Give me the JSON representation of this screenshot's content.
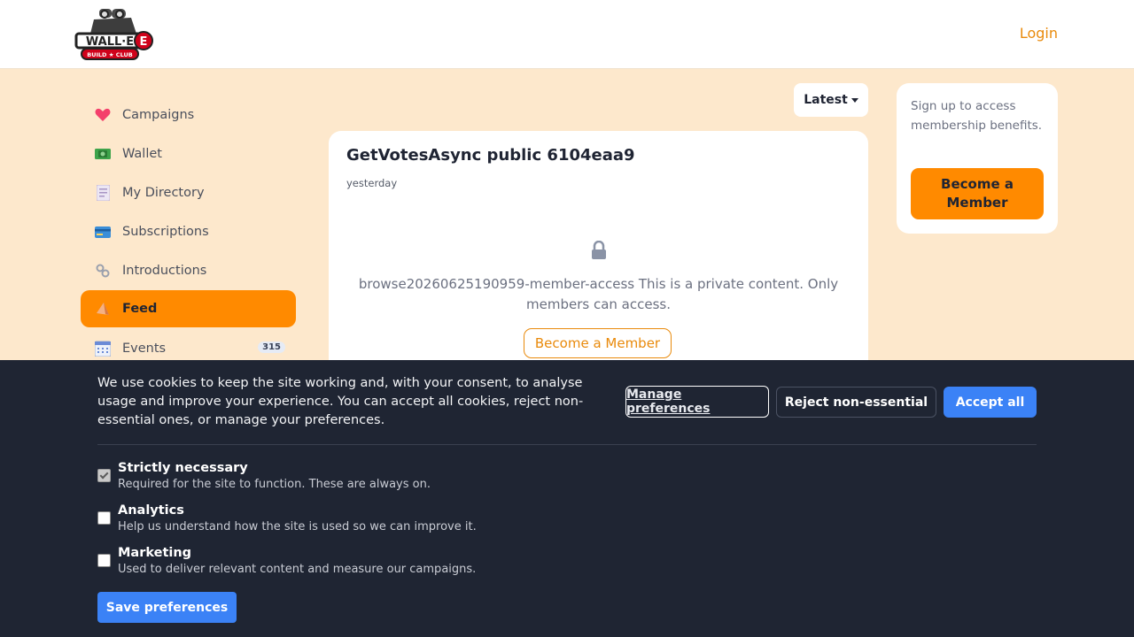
{
  "header": {
    "logo_text": "WALL·E",
    "logo_subtext": "BUILD ★ CLUB",
    "login_label": "Login"
  },
  "sidebar": {
    "items": [
      {
        "label": "Campaigns",
        "icon": "heart-icon"
      },
      {
        "label": "Wallet",
        "icon": "money-icon"
      },
      {
        "label": "My Directory",
        "icon": "document-icon"
      },
      {
        "label": "Subscriptions",
        "icon": "credit-card-icon"
      },
      {
        "label": "Introductions",
        "icon": "link-icon"
      },
      {
        "label": "Feed",
        "icon": "megaphone-icon",
        "active": true
      },
      {
        "label": "Events",
        "icon": "calendar-icon",
        "badge": "315"
      }
    ]
  },
  "feed": {
    "sort_label": "Latest",
    "post": {
      "title": "GetVotesAsync public 6104eaa9",
      "time": "yesterday",
      "private_message": "browse20260625190959-member-access This is a private content. Only members can access.",
      "cta_label": "Become a Member"
    }
  },
  "membership_card": {
    "text": "Sign up to access membership benefits.",
    "button_label": "Become a Member"
  },
  "cookie_banner": {
    "message": "We use cookies to keep the site working and, with your consent, to analyse usage and improve your experience. You can accept all cookies, reject non-essential ones, or manage your preferences.",
    "manage_label": "Manage preferences",
    "reject_label": "Reject non-essential",
    "accept_label": "Accept all",
    "preferences": [
      {
        "name": "Strictly necessary",
        "description": "Required for the site to function. These are always on.",
        "checked": true
      },
      {
        "name": "Analytics",
        "description": "Help us understand how the site is used so we can improve it.",
        "checked": false
      },
      {
        "name": "Marketing",
        "description": "Used to deliver relevant content and measure our campaigns.",
        "checked": false
      }
    ],
    "save_label": "Save preferences"
  },
  "colors": {
    "accent": "#ff8a00",
    "page_background": "#fde8cc",
    "banner_background": "#1f2533",
    "primary_button": "#3b82f6"
  }
}
